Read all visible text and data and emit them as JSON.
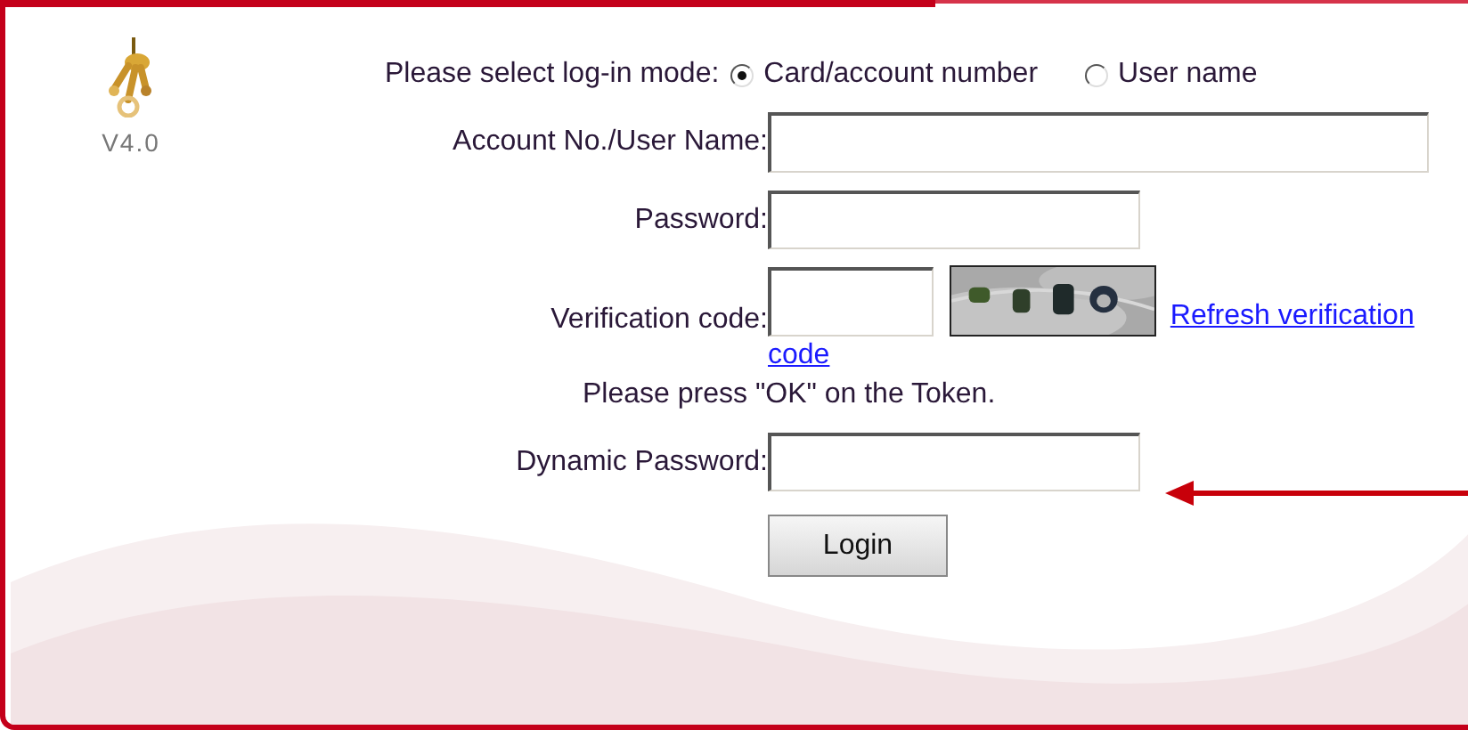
{
  "logo": {
    "version": "V4.0"
  },
  "login_mode": {
    "label": "Please select log-in mode:",
    "options": [
      {
        "label": "Card/account number",
        "selected": true
      },
      {
        "label": "User name",
        "selected": false
      }
    ]
  },
  "fields": [
    {
      "kind": "wide",
      "label": "Account No./User Name:"
    },
    {
      "kind": "medium",
      "label": "Password:"
    },
    {
      "kind": "captcha",
      "label": "Verification code:",
      "link_lines": [
        "Refresh verification",
        "code"
      ]
    },
    {
      "kind": "note",
      "text": "Please press \"OK\" on the Token."
    },
    {
      "kind": "medium",
      "label": "Dynamic Password:",
      "pointer_arrow": true
    }
  ],
  "login_button": "Login"
}
